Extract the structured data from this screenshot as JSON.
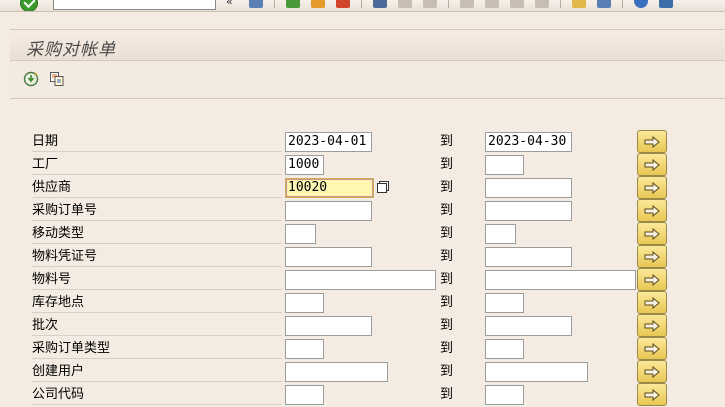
{
  "screen": {
    "title": "采购对帐单"
  },
  "toolbar": {
    "command_field_value": "",
    "chevron": "«"
  },
  "app_toolbar": {
    "execute_icon": "execute-icon",
    "variant_icon": "get-variant-icon"
  },
  "to_label": "到",
  "fields": [
    {
      "label": "日期",
      "low": "2023-04-01",
      "high": "2023-04-30"
    },
    {
      "label": "工厂",
      "low": "1000",
      "high": ""
    },
    {
      "label": "供应商",
      "low": "10020",
      "high": ""
    },
    {
      "label": "采购订单号",
      "low": "",
      "high": ""
    },
    {
      "label": "移动类型",
      "low": "",
      "high": ""
    },
    {
      "label": "物料凭证号",
      "low": "",
      "high": ""
    },
    {
      "label": "物料号",
      "low": "",
      "high": ""
    },
    {
      "label": "库存地点",
      "low": "",
      "high": ""
    },
    {
      "label": "批次",
      "low": "",
      "high": ""
    },
    {
      "label": "采购订单类型",
      "low": "",
      "high": ""
    },
    {
      "label": "创建用户",
      "low": "",
      "high": ""
    },
    {
      "label": "公司代码",
      "low": "",
      "high": ""
    }
  ],
  "colors": {
    "background": "#f4ebe2",
    "focus_field": "#fdf7b1",
    "multi_select_button": "#f0d36b"
  }
}
